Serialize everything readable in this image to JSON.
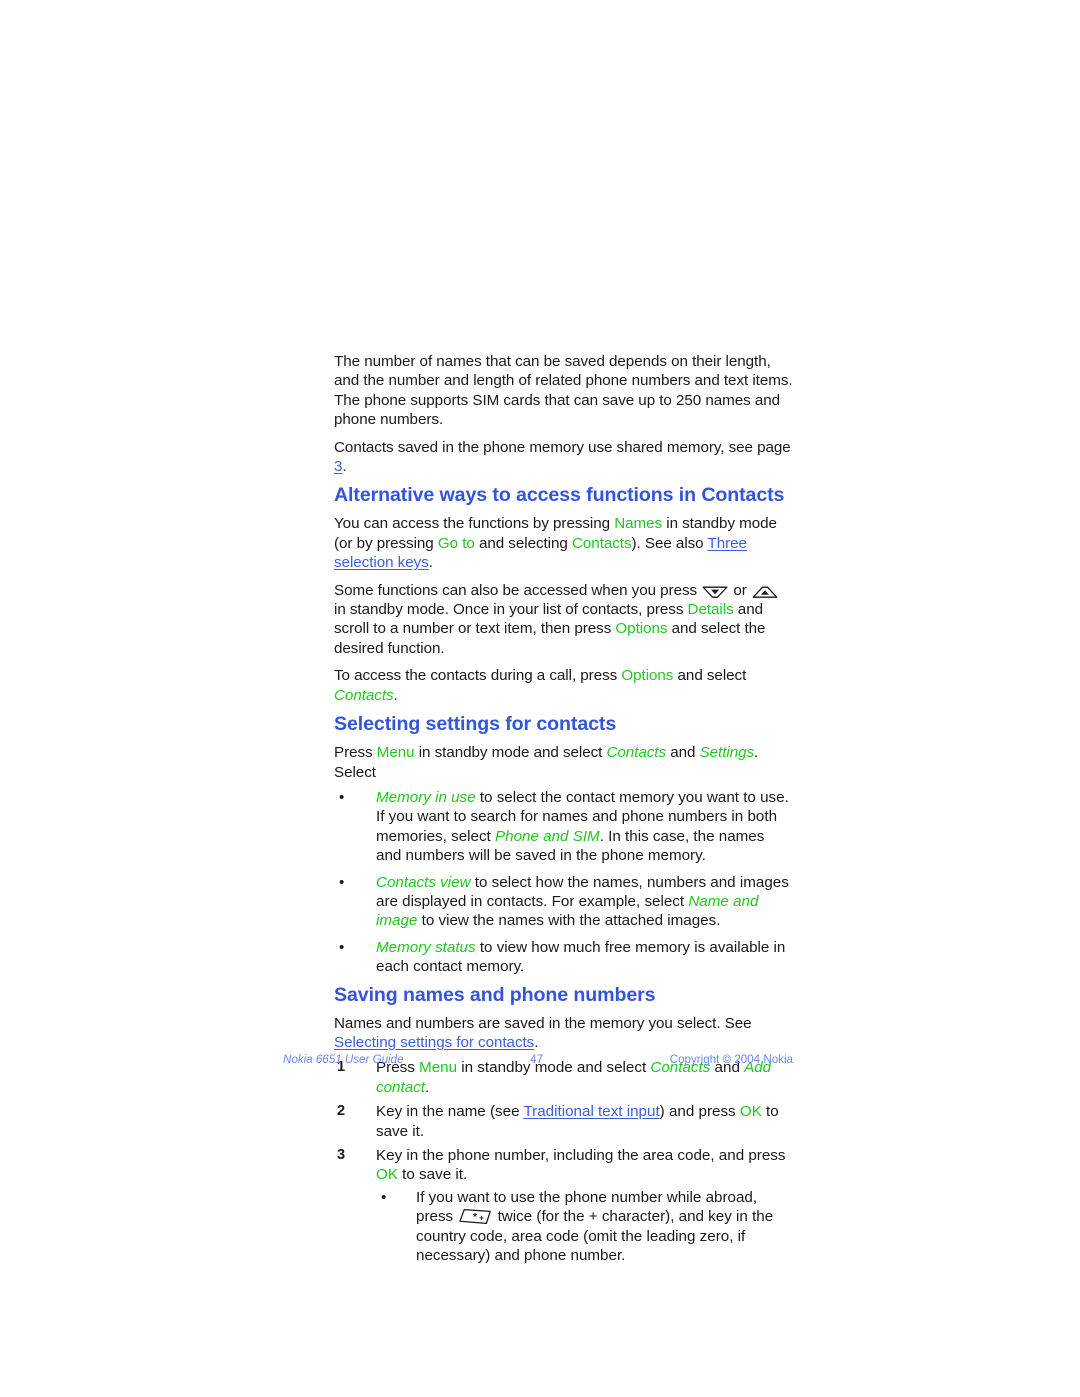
{
  "document": {
    "title": "Nokia 6651 User Guide",
    "page_number": "47",
    "copyright": "Copyright © 2004 Nokia"
  },
  "colors": {
    "heading": "#3355DD",
    "link": "#3A5FE0",
    "ui_accent_green": "#1FC81F",
    "body_text": "#1A1A1A",
    "footer": "#6B87EE",
    "page_background": "#FFFFFF"
  },
  "content": {
    "intro_paragraph": {
      "text": "The number of names that can be saved depends on their length, and the number and length of related phone numbers and text items. The phone supports SIM cards that can save up to 250 names and phone numbers."
    },
    "shared_memory_paragraph": {
      "prefix": "Contacts saved in the phone memory use shared memory, see page ",
      "link": "3",
      "suffix": "."
    },
    "section_alternative": {
      "heading": "Alternative ways to access functions in Contacts",
      "p1": {
        "s1": "You can access the functions by pressing ",
        "ui1": "Names",
        "s2": " in standby mode (or by pressing ",
        "ui2": "Go to",
        "s3": " and selecting ",
        "ui3": "Contacts",
        "s4": "). See also ",
        "link1": "Three selection keys",
        "s5": "."
      },
      "p2": {
        "s1": "Some functions can also be accessed when you press ",
        "key_down": "scroll-down-key",
        "s2": " or ",
        "key_up": "scroll-up-key",
        "s3": " in standby mode. Once in your list of contacts, press ",
        "ui1": "Details",
        "s4": " and scroll to a number or text item, then press ",
        "ui2": "Options",
        "s5": " and select the desired function."
      },
      "p3": {
        "s1": "To access the contacts during a call, press ",
        "ui1": "Options",
        "s2": " and select ",
        "menu1": "Contacts",
        "s3": "."
      }
    },
    "section_settings": {
      "heading": "Selecting settings for contacts",
      "intro": {
        "s1": "Press ",
        "ui1": "Menu",
        "s2": " in standby mode and select ",
        "menu1": "Contacts",
        "s3": " and ",
        "menu2": "Settings",
        "s4": ". Select"
      },
      "bullet_marker": "•",
      "bullets": [
        {
          "menu1": "Memory in use",
          "s1": " to select the contact memory you want to use. If you want to search for names and phone numbers in both memories, select ",
          "menu2": "Phone and SIM",
          "s2": ". In this case, the names and numbers will be saved in the phone memory."
        },
        {
          "menu1": "Contacts view",
          "s1": " to select how the names, numbers and images are displayed in contacts. For example, select ",
          "menu2": "Name and image",
          "s2": " to view the names with the attached images."
        },
        {
          "menu1": "Memory status",
          "s1": " to view how much free memory is available in each contact memory.",
          "menu2": "",
          "s2": ""
        }
      ]
    },
    "section_saving": {
      "heading": "Saving names and phone numbers",
      "intro": {
        "s1": "Names and numbers are saved in the memory you select. See ",
        "link1": "Selecting settings for contacts",
        "s2": "."
      },
      "steps": [
        {
          "number": "1",
          "s1": "Press ",
          "ui1": "Menu",
          "s2": " in standby mode and select ",
          "menu1": "Contacts",
          "s3": " and ",
          "menu2": "Add contact",
          "s4": "."
        },
        {
          "number": "2",
          "s1": "Key in the name (see ",
          "link1": "Traditional text input",
          "s2": ") and press ",
          "ui1": "OK",
          "s3": " to save it."
        },
        {
          "number": "3",
          "s1": "Key in the phone number, including the area code, and press ",
          "ui1": "OK",
          "s2": " to save it."
        }
      ],
      "sub_bullet": {
        "marker": "•",
        "s1": "If you want to use the phone number while abroad, press ",
        "key_star": "star-plus-key",
        "s2": " twice (for the + character), and key in the country code, area code (omit the leading zero, if necessary) and phone number."
      }
    }
  }
}
